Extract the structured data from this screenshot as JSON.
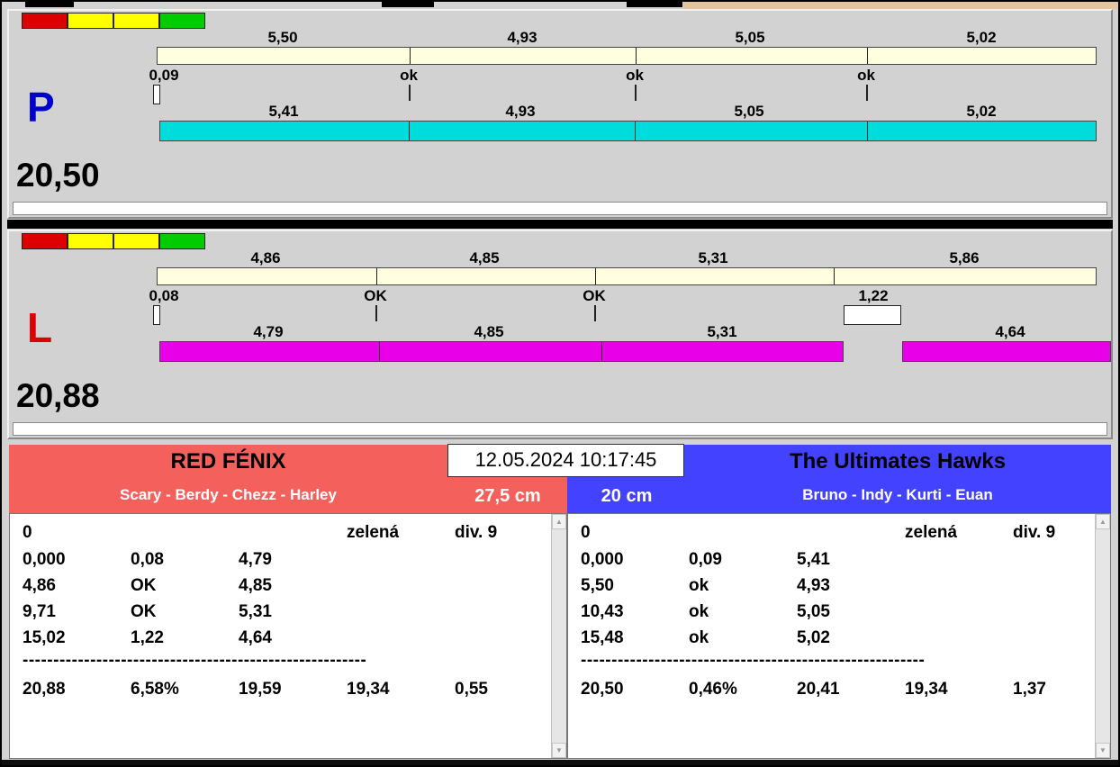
{
  "window": {
    "bg_color": "#d2d2d2",
    "taskbar_color": "#0e0e0e",
    "datetime": "12.05.2024 10:17:45"
  },
  "icons": {
    "scroll_up": "▲",
    "scroll_down": "▼"
  },
  "status_lights": [
    "#dd0000",
    "#ffff00",
    "#ffff00",
    "#00cc00"
  ],
  "lanes": [
    {
      "letter": "P",
      "letter_color": "#0000cc",
      "total": "20,50",
      "ref_bar_color": "#ffffe0",
      "run_bar_color": "#00dcdc",
      "ref_labels": [
        "5,50",
        "4,93",
        "5,05",
        "5,02"
      ],
      "mark_labels": [
        "0,09",
        "ok",
        "ok",
        "ok"
      ],
      "run_labels": [
        "5,41",
        "4,93",
        "5,05",
        "5,02"
      ],
      "ref_values": [
        5.5,
        4.93,
        5.05,
        5.02
      ],
      "run_values": [
        5.41,
        4.93,
        5.05,
        5.02
      ]
    },
    {
      "letter": "L",
      "letter_color": "#dd0000",
      "total": "20,88",
      "ref_bar_color": "#ffffe0",
      "run_bar_color": "#e800e8",
      "ref_labels": [
        "4,86",
        "4,85",
        "5,31",
        "5,86"
      ],
      "mark_labels": [
        "0,08",
        "OK",
        "OK",
        "1,22"
      ],
      "run_labels": [
        "4,79",
        "4,85",
        "5,31",
        "4,64"
      ],
      "ref_values": [
        4.86,
        4.85,
        5.31,
        5.86
      ],
      "run_values": [
        4.79,
        4.85,
        5.31,
        4.64
      ]
    }
  ],
  "teams": [
    {
      "name": "RED FÉNIX",
      "members": "Scary - Berdy - Chezz - Harley",
      "header_color": "#f4605c",
      "badge": "27,5 cm",
      "header_row": [
        "0",
        "",
        "",
        "zelená",
        "div. 9"
      ],
      "rows": [
        [
          "0,000",
          "0,08",
          "4,79"
        ],
        [
          "4,86",
          "OK",
          "4,85"
        ],
        [
          "9,71",
          "OK",
          "5,31"
        ],
        [
          "15,02",
          "1,22",
          "4,64"
        ]
      ],
      "separator": "--------------------------------------------------------",
      "totals": [
        "20,88",
        "6,58%",
        "19,59",
        "19,34",
        "0,55"
      ]
    },
    {
      "name": "The Ultimates Hawks",
      "members": "Bruno - Indy - Kurti - Euan",
      "header_color": "#4343ff",
      "badge": "20 cm",
      "header_row": [
        "0",
        "",
        "",
        "zelená",
        "div. 9"
      ],
      "rows": [
        [
          "0,000",
          "0,09",
          "5,41"
        ],
        [
          "5,50",
          "ok",
          "4,93"
        ],
        [
          "10,43",
          "ok",
          "5,05"
        ],
        [
          "15,48",
          "ok",
          "5,02"
        ]
      ],
      "separator": "--------------------------------------------------------",
      "totals": [
        "20,50",
        "0,46%",
        "20,41",
        "19,34",
        "1,37"
      ]
    }
  ]
}
